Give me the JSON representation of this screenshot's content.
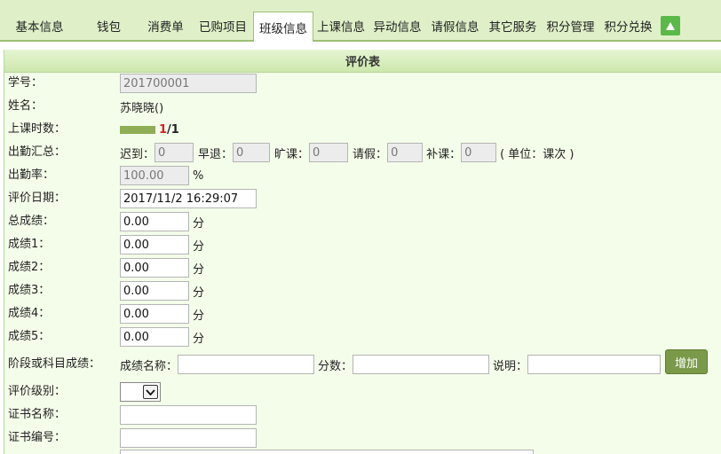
{
  "tabs": [
    {
      "label": "基本信息"
    },
    {
      "label": "钱包"
    },
    {
      "label": "消费单"
    },
    {
      "label": "已购项目"
    },
    {
      "label": "班级信息"
    },
    {
      "label": "上课信息"
    },
    {
      "label": "异动信息"
    },
    {
      "label": "请假信息"
    },
    {
      "label": "其它服务"
    },
    {
      "label": "积分管理"
    },
    {
      "label": "积分兑换"
    }
  ],
  "panel": {
    "title": "评价表"
  },
  "form": {
    "student_no": {
      "label": "学号：",
      "value": "201700001"
    },
    "name": {
      "label": "姓名：",
      "value": "苏晓晓()"
    },
    "class_hours": {
      "label": "上课时数：",
      "progress": 1.0,
      "done": "1",
      "total": "/1"
    },
    "attendance": {
      "label": "出勤汇总：",
      "late_label": "迟到：",
      "late": "0",
      "early_label": "早退：",
      "early": "0",
      "absent_label": "旷课：",
      "absent": "0",
      "leave_label": "请假：",
      "leave": "0",
      "makeup_label": "补课：",
      "makeup": "0",
      "unit_note": "( 单位：课次 )"
    },
    "attendance_rate": {
      "label": "出勤率：",
      "value": "100.00",
      "unit": "%"
    },
    "eval_date": {
      "label": "评价日期：",
      "value": "2017/11/2 16:29:07"
    },
    "total_score": {
      "label": "总成绩：",
      "value": "0.00",
      "unit": "分"
    },
    "scores": [
      {
        "label": "成绩1：",
        "value": "0.00",
        "unit": "分"
      },
      {
        "label": "成绩2：",
        "value": "0.00",
        "unit": "分"
      },
      {
        "label": "成绩3：",
        "value": "0.00",
        "unit": "分"
      },
      {
        "label": "成绩4：",
        "value": "0.00",
        "unit": "分"
      },
      {
        "label": "成绩5：",
        "value": "0.00",
        "unit": "分"
      }
    ],
    "stage_score": {
      "label": "阶段或科目成绩：",
      "name_label": "成绩名称：",
      "name_value": "",
      "score_label": "分数：",
      "score_value": "",
      "desc_label": "说明：",
      "desc_value": "",
      "add_button": "增加"
    },
    "eval_level": {
      "label": "评价级别：",
      "selected": ""
    },
    "cert_name": {
      "label": "证书名称：",
      "value": ""
    },
    "cert_no": {
      "label": "证书编号：",
      "value": ""
    }
  },
  "colors": {
    "tabbar_bg": "#dff0c8",
    "panel_bg": "#f4fdea",
    "accent": "#5bb94a",
    "button": "#7a9a4a",
    "highlight": "#d02020"
  },
  "icons": {
    "scroll_top": "triangle-up-icon",
    "select_arrow": "chevron-down-icon"
  }
}
